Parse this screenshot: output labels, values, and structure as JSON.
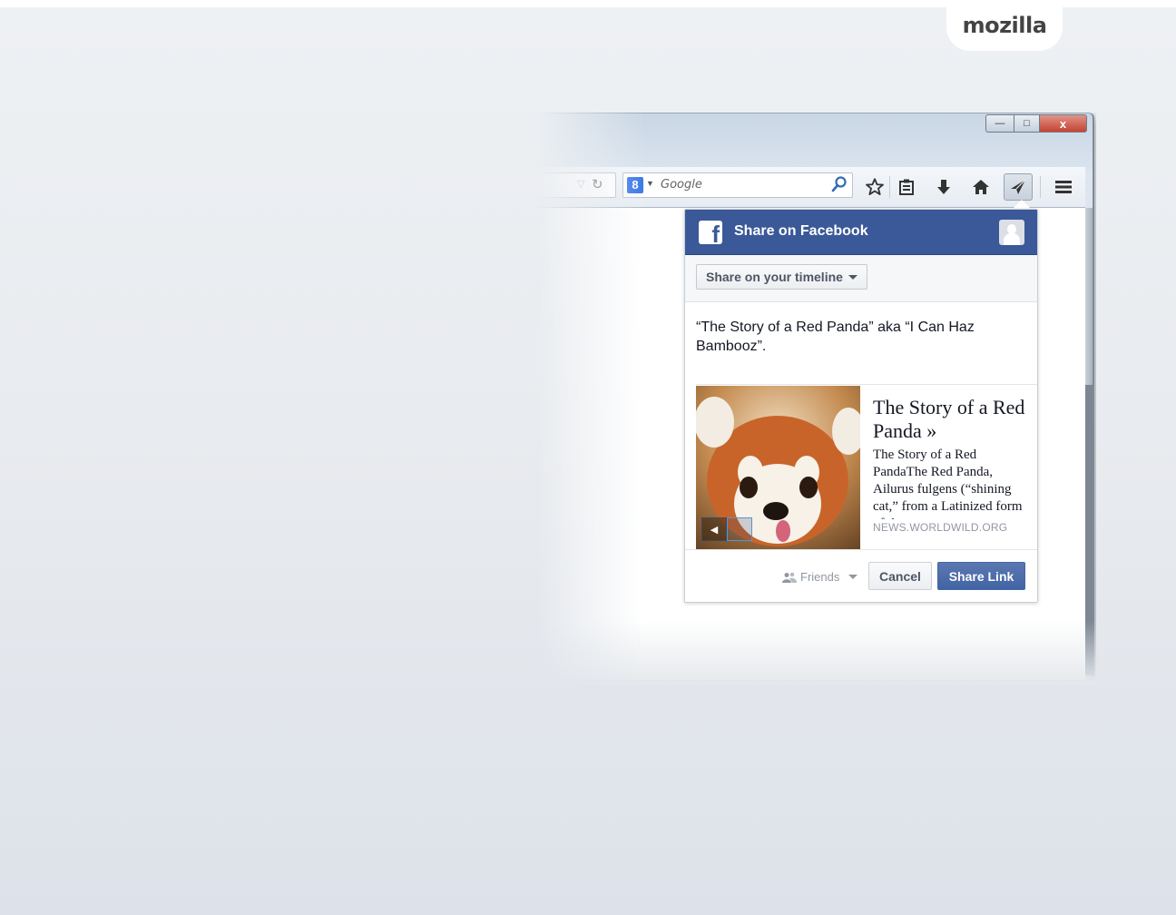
{
  "brand": {
    "label": "mozilla"
  },
  "window": {
    "minimize_glyph": "—",
    "maximize_glyph": "□",
    "close_glyph": "x"
  },
  "toolbar": {
    "search_placeholder": "Google",
    "icons": [
      "reload-icon",
      "search-engine-icon",
      "search-icon",
      "bookmark-star-icon",
      "bookmarks-list-icon",
      "download-icon",
      "home-icon",
      "share-icon",
      "menu-icon"
    ]
  },
  "share_panel": {
    "title": "Share on Facebook",
    "target_selector": "Share on your timeline",
    "message": "“The Story of a Red Panda” aka “I Can Haz Bambooz”.",
    "preview": {
      "title": "The Story of a Red Panda »",
      "description": "The Story of a Red PandaThe Red Panda, Ailurus fulgens (“shining cat,” from a Latinized form of the",
      "domain": "NEWS.WORLDWILD.ORG"
    },
    "audience": "Friends",
    "cancel_label": "Cancel",
    "share_label": "Share Link",
    "colors": {
      "facebook_blue": "#3b5998",
      "share_button": "#4e69a2"
    }
  }
}
